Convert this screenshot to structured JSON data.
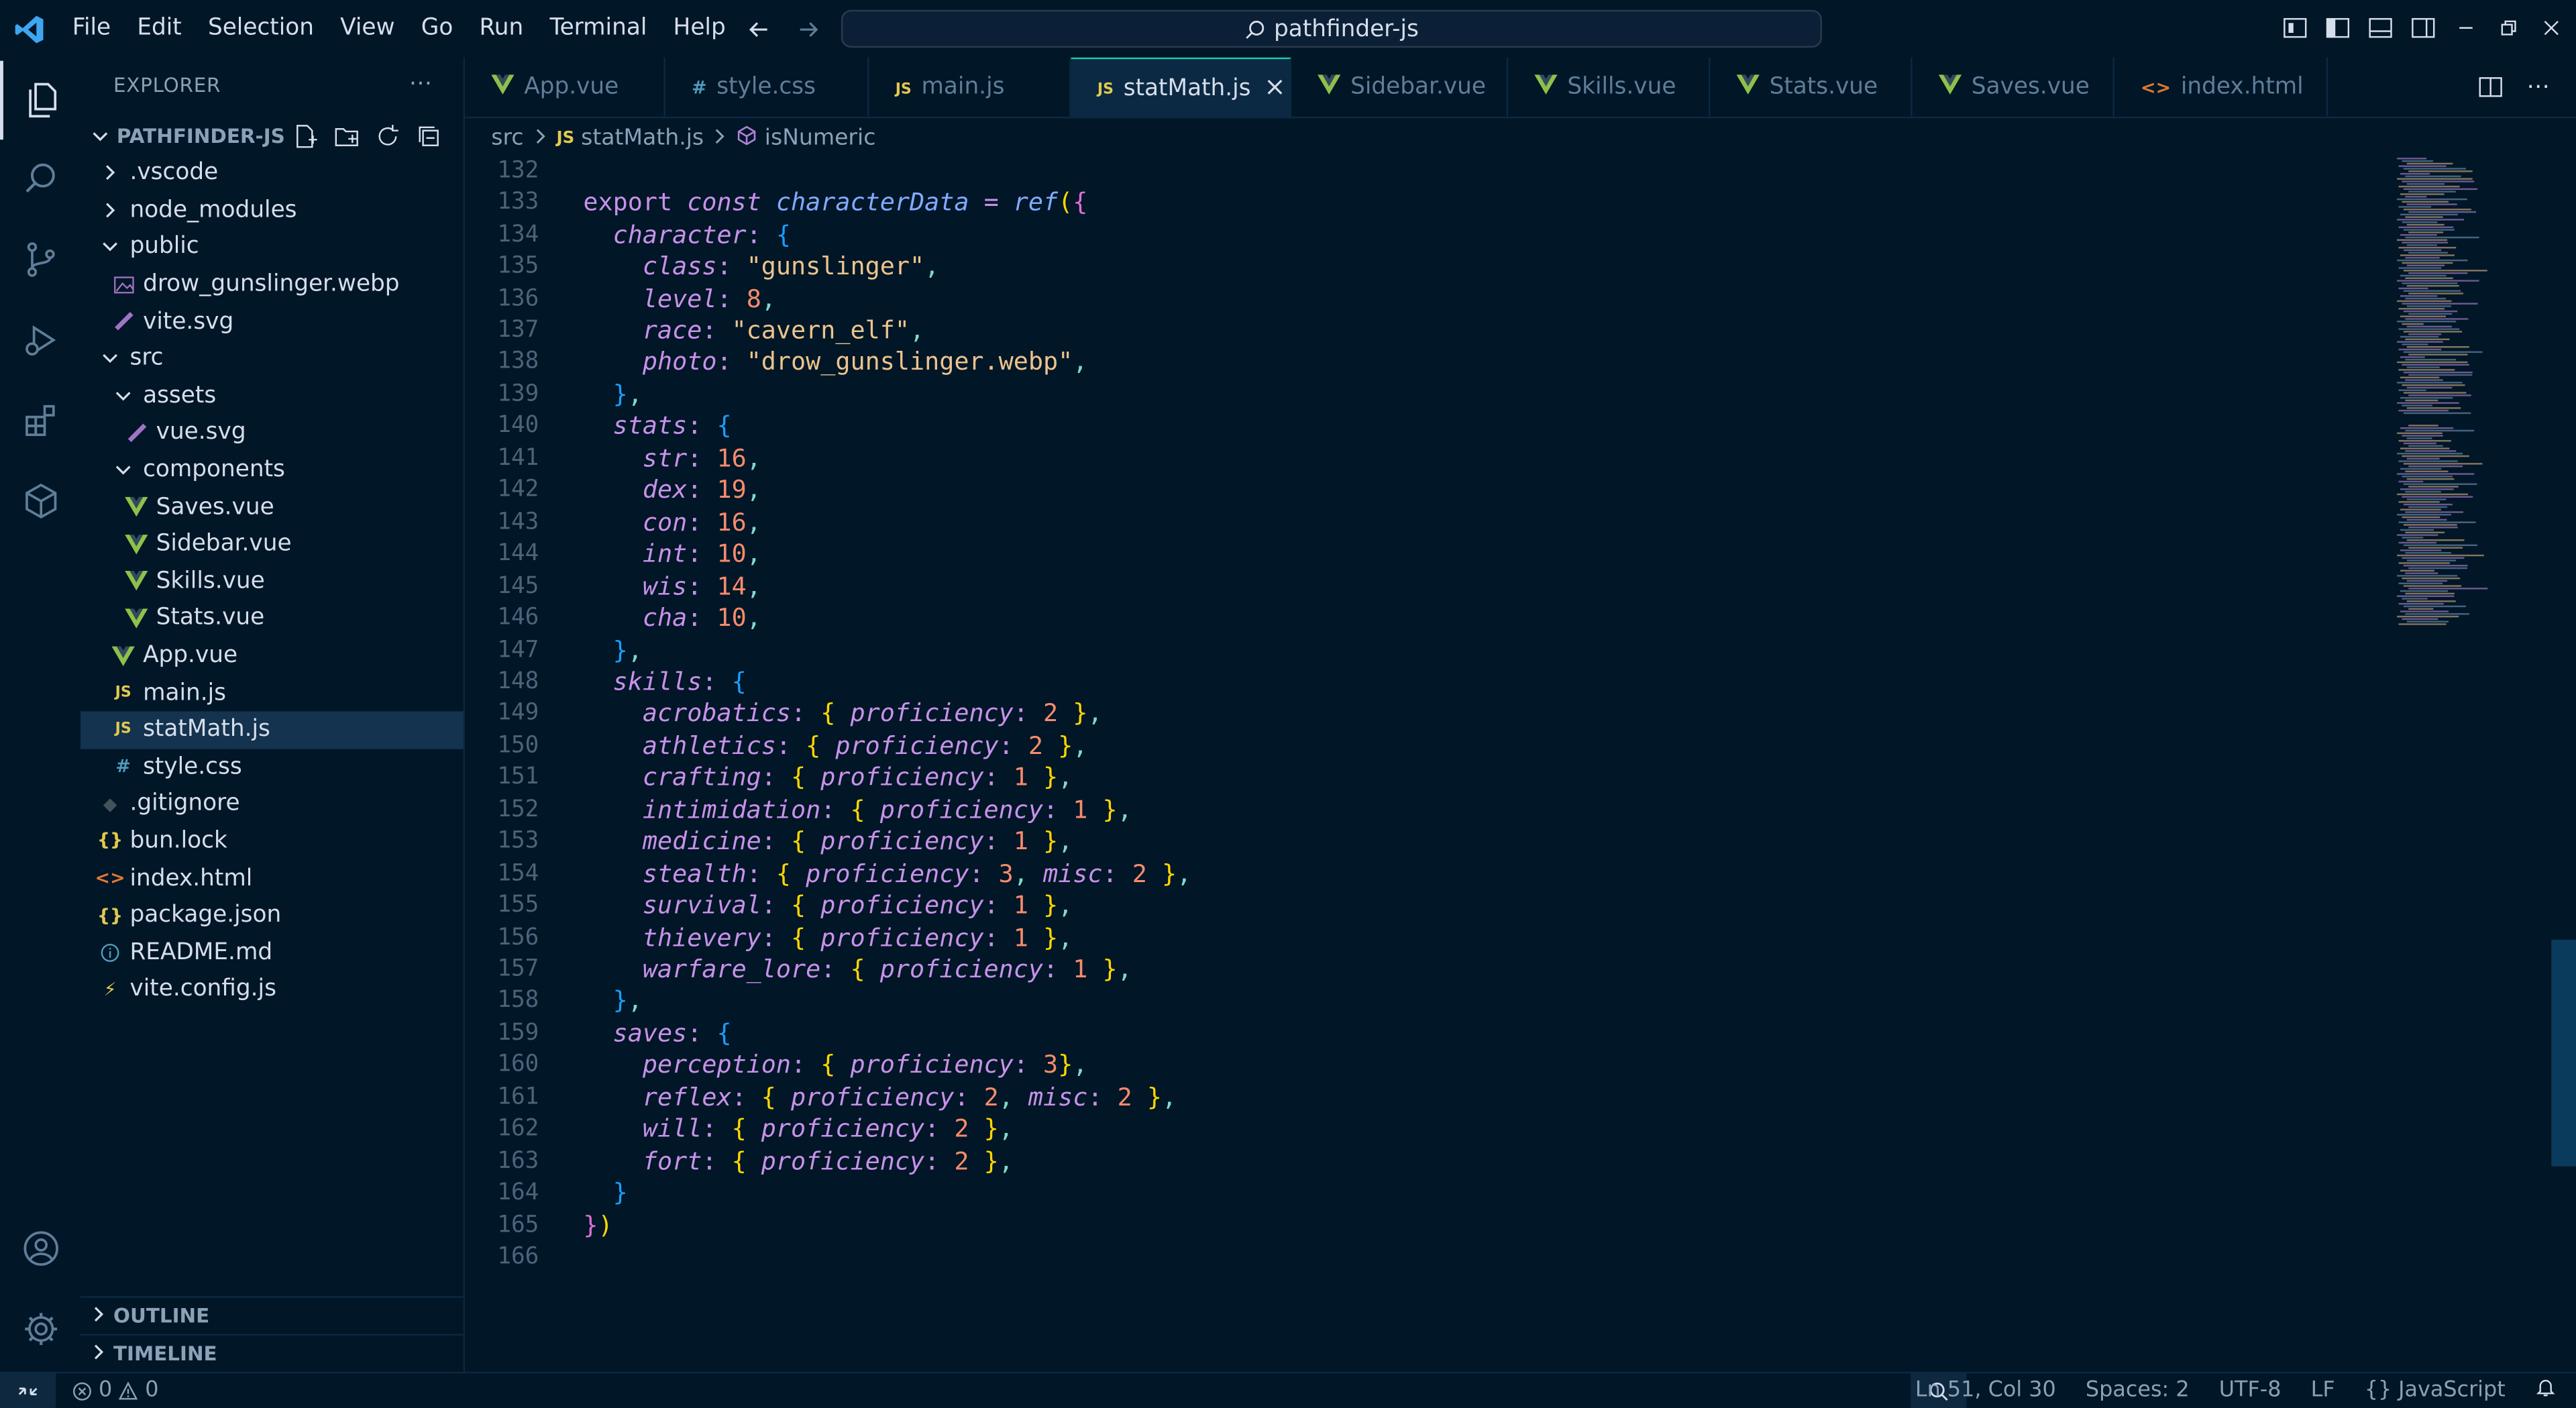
{
  "menu": [
    "File",
    "Edit",
    "Selection",
    "View",
    "Go",
    "Run",
    "Terminal",
    "Help"
  ],
  "search": {
    "text": "pathfinder-js"
  },
  "sidebar": {
    "title": "EXPLORER",
    "project": "PATHFINDER-JS",
    "items": [
      {
        "label": ".vscode",
        "type": "folder-closed",
        "indent": 1
      },
      {
        "label": "node_modules",
        "type": "folder-closed",
        "indent": 1
      },
      {
        "label": "public",
        "type": "folder-open",
        "indent": 1
      },
      {
        "label": "drow_gunslinger.webp",
        "type": "image",
        "indent": 2
      },
      {
        "label": "vite.svg",
        "type": "svg",
        "indent": 2
      },
      {
        "label": "src",
        "type": "folder-open",
        "indent": 1
      },
      {
        "label": "assets",
        "type": "folder-open",
        "indent": 2
      },
      {
        "label": "vue.svg",
        "type": "svg",
        "indent": 3
      },
      {
        "label": "components",
        "type": "folder-open",
        "indent": 2
      },
      {
        "label": "Saves.vue",
        "type": "vue",
        "indent": 3
      },
      {
        "label": "Sidebar.vue",
        "type": "vue",
        "indent": 3
      },
      {
        "label": "Skills.vue",
        "type": "vue",
        "indent": 3
      },
      {
        "label": "Stats.vue",
        "type": "vue",
        "indent": 3
      },
      {
        "label": "App.vue",
        "type": "vue",
        "indent": 2
      },
      {
        "label": "main.js",
        "type": "js",
        "indent": 2
      },
      {
        "label": "statMath.js",
        "type": "js",
        "indent": 2,
        "selected": true
      },
      {
        "label": "style.css",
        "type": "css",
        "indent": 2
      },
      {
        "label": ".gitignore",
        "type": "git",
        "indent": 1
      },
      {
        "label": "bun.lock",
        "type": "json",
        "indent": 1
      },
      {
        "label": "index.html",
        "type": "html",
        "indent": 1
      },
      {
        "label": "package.json",
        "type": "json",
        "indent": 1
      },
      {
        "label": "README.md",
        "type": "info",
        "indent": 1
      },
      {
        "label": "vite.config.js",
        "type": "vite",
        "indent": 1
      }
    ],
    "outline": "OUTLINE",
    "timeline": "TIMELINE"
  },
  "tabs": [
    {
      "label": "App.vue",
      "type": "vue"
    },
    {
      "label": "style.css",
      "type": "css"
    },
    {
      "label": "main.js",
      "type": "js"
    },
    {
      "label": "statMath.js",
      "type": "js",
      "active": true
    },
    {
      "label": "Sidebar.vue",
      "type": "vue"
    },
    {
      "label": "Skills.vue",
      "type": "vue"
    },
    {
      "label": "Stats.vue",
      "type": "vue"
    },
    {
      "label": "Saves.vue",
      "type": "vue"
    },
    {
      "label": "index.html",
      "type": "html"
    }
  ],
  "breadcrumb": {
    "folder": "src",
    "file": "statMath.js",
    "symbol": "isNumeric"
  },
  "editor": {
    "lines": [
      {
        "n": "132",
        "html": ""
      },
      {
        "n": "133",
        "html": "<span class='kw2'>export</span> <span class='kw'>const</span> <span class='var'>characterData</span> <span class='punc'>=</span> <span class='fn'>ref</span><span class='brace1'>(</span><span class='brace2'>{</span>"
      },
      {
        "n": "134",
        "html": "  <span class='pk'>character</span><span class='punc'>:</span> <span class='brace3'>{</span>"
      },
      {
        "n": "135",
        "html": "    <span class='pk'>class</span><span class='punc'>:</span> <span class='str'>\"gunslinger\"</span><span class='comma'>,</span>"
      },
      {
        "n": "136",
        "html": "    <span class='pk'>level</span><span class='punc'>:</span> <span class='num'>8</span><span class='comma'>,</span>"
      },
      {
        "n": "137",
        "html": "    <span class='pk'>race</span><span class='punc'>:</span> <span class='str'>\"cavern_elf\"</span><span class='comma'>,</span>"
      },
      {
        "n": "138",
        "html": "    <span class='pk'>photo</span><span class='punc'>:</span> <span class='str'>\"drow_gunslinger.webp\"</span><span class='comma'>,</span>"
      },
      {
        "n": "139",
        "html": "  <span class='brace3'>}</span><span class='comma'>,</span>"
      },
      {
        "n": "140",
        "html": "  <span class='pk'>stats</span><span class='punc'>:</span> <span class='brace3'>{</span>"
      },
      {
        "n": "141",
        "html": "    <span class='pk'>str</span><span class='punc'>:</span> <span class='num'>16</span><span class='comma'>,</span>"
      },
      {
        "n": "142",
        "html": "    <span class='pk'>dex</span><span class='punc'>:</span> <span class='num'>19</span><span class='comma'>,</span>"
      },
      {
        "n": "143",
        "html": "    <span class='pk'>con</span><span class='punc'>:</span> <span class='num'>16</span><span class='comma'>,</span>"
      },
      {
        "n": "144",
        "html": "    <span class='pk'>int</span><span class='punc'>:</span> <span class='num'>10</span><span class='comma'>,</span>"
      },
      {
        "n": "145",
        "html": "    <span class='pk'>wis</span><span class='punc'>:</span> <span class='num'>14</span><span class='comma'>,</span>"
      },
      {
        "n": "146",
        "html": "    <span class='pk'>cha</span><span class='punc'>:</span> <span class='num'>10</span><span class='comma'>,</span>"
      },
      {
        "n": "147",
        "html": "  <span class='brace3'>}</span><span class='comma'>,</span>"
      },
      {
        "n": "148",
        "html": "  <span class='pk'>skills</span><span class='punc'>:</span> <span class='brace3'>{</span>"
      },
      {
        "n": "149",
        "html": "    <span class='pk'>acrobatics</span><span class='punc'>:</span> <span class='brace1'>{</span> <span class='pk'>proficiency</span><span class='punc'>:</span> <span class='num'>2</span> <span class='brace1'>}</span><span class='comma'>,</span>"
      },
      {
        "n": "150",
        "html": "    <span class='pk'>athletics</span><span class='punc'>:</span> <span class='brace1'>{</span> <span class='pk'>proficiency</span><span class='punc'>:</span> <span class='num'>2</span> <span class='brace1'>}</span><span class='comma'>,</span>"
      },
      {
        "n": "151",
        "html": "    <span class='pk'>crafting</span><span class='punc'>:</span> <span class='brace1'>{</span> <span class='pk'>proficiency</span><span class='punc'>:</span> <span class='num'>1</span> <span class='brace1'>}</span><span class='comma'>,</span>"
      },
      {
        "n": "152",
        "html": "    <span class='pk'>intimidation</span><span class='punc'>:</span> <span class='brace1'>{</span> <span class='pk'>proficiency</span><span class='punc'>:</span> <span class='num'>1</span> <span class='brace1'>}</span><span class='comma'>,</span>"
      },
      {
        "n": "153",
        "html": "    <span class='pk'>medicine</span><span class='punc'>:</span> <span class='brace1'>{</span> <span class='pk'>proficiency</span><span class='punc'>:</span> <span class='num'>1</span> <span class='brace1'>}</span><span class='comma'>,</span>"
      },
      {
        "n": "154",
        "html": "    <span class='pk'>stealth</span><span class='punc'>:</span> <span class='brace1'>{</span> <span class='pk'>proficiency</span><span class='punc'>:</span> <span class='num'>3</span><span class='comma'>,</span> <span class='pk'>misc</span><span class='punc'>:</span> <span class='num'>2</span> <span class='brace1'>}</span><span class='comma'>,</span>"
      },
      {
        "n": "155",
        "html": "    <span class='pk'>survival</span><span class='punc'>:</span> <span class='brace1'>{</span> <span class='pk'>proficiency</span><span class='punc'>:</span> <span class='num'>1</span> <span class='brace1'>}</span><span class='comma'>,</span>"
      },
      {
        "n": "156",
        "html": "    <span class='pk'>thievery</span><span class='punc'>:</span> <span class='brace1'>{</span> <span class='pk'>proficiency</span><span class='punc'>:</span> <span class='num'>1</span> <span class='brace1'>}</span><span class='comma'>,</span>"
      },
      {
        "n": "157",
        "html": "    <span class='pk'>warfare_lore</span><span class='punc'>:</span> <span class='brace1'>{</span> <span class='pk'>proficiency</span><span class='punc'>:</span> <span class='num'>1</span> <span class='brace1'>}</span><span class='comma'>,</span>"
      },
      {
        "n": "158",
        "html": "  <span class='brace3'>}</span><span class='comma'>,</span>"
      },
      {
        "n": "159",
        "html": "  <span class='pk'>saves</span><span class='punc'>:</span> <span class='brace3'>{</span>"
      },
      {
        "n": "160",
        "html": "    <span class='pk'>perception</span><span class='punc'>:</span> <span class='brace1'>{</span> <span class='pk'>proficiency</span><span class='punc'>:</span> <span class='num'>3</span><span class='brace1'>}</span><span class='comma'>,</span>"
      },
      {
        "n": "161",
        "html": "    <span class='pk'>reflex</span><span class='punc'>:</span> <span class='brace1'>{</span> <span class='pk'>proficiency</span><span class='punc'>:</span> <span class='num'>2</span><span class='comma'>,</span> <span class='pk'>misc</span><span class='punc'>:</span> <span class='num'>2</span> <span class='brace1'>}</span><span class='comma'>,</span>"
      },
      {
        "n": "162",
        "html": "    <span class='pk'>will</span><span class='punc'>:</span> <span class='brace1'>{</span> <span class='pk'>proficiency</span><span class='punc'>:</span> <span class='num'>2</span> <span class='brace1'>}</span><span class='comma'>,</span>"
      },
      {
        "n": "163",
        "html": "    <span class='pk'>fort</span><span class='punc'>:</span> <span class='brace1'>{</span> <span class='pk'>proficiency</span><span class='punc'>:</span> <span class='num'>2</span> <span class='brace1'>}</span><span class='comma'>,</span>"
      },
      {
        "n": "164",
        "html": "  <span class='brace3'>}</span>"
      },
      {
        "n": "165",
        "html": "<span class='brace2'>}</span><span class='brace1'>)</span>"
      },
      {
        "n": "166",
        "html": ""
      }
    ]
  },
  "status": {
    "errors": "0",
    "warnings": "0",
    "position": "Ln 51, Col 30",
    "spaces": "Spaces: 2",
    "encoding": "UTF-8",
    "eol": "LF",
    "language": "JavaScript"
  },
  "colors": {
    "background": "#011627",
    "accent": "#21c7a8",
    "selection": "#234d70"
  }
}
